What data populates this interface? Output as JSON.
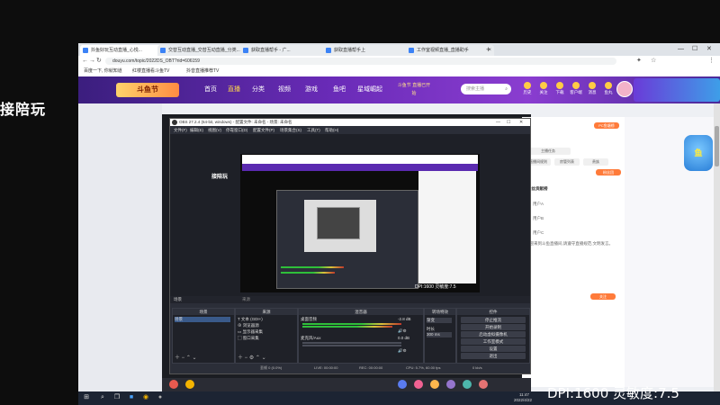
{
  "browser": {
    "tabs": [
      {
        "label": "抖鱼好玩互动直播_心悦...",
        "active": true
      },
      {
        "label": "交替互动直播_交替互动直播_分类..."
      },
      {
        "label": "获取直播帮手 - 广..."
      },
      {
        "label": "获取直播帮手上"
      },
      {
        "label": "工作室视频直播_直播助手"
      }
    ],
    "new_tab": "+",
    "window_controls": [
      "—",
      "☐",
      "✕"
    ],
    "url": "douyu.com/topic/2022DS_OBT?rid=606159",
    "bookmarks": [
      "百度一下, 你就知道",
      "红楼直播看斗鱼TV",
      "抖音直播推荐TV"
    ]
  },
  "site": {
    "logo": "斗鱼节",
    "nav": [
      "首页",
      "直播",
      "分类",
      "视频",
      "游戏",
      "鱼吧",
      "星域崛起"
    ],
    "nav_active": 1,
    "promo": "斗鱼节 直播已开始",
    "search_placeholder": "搜索主播",
    "top_icons": [
      "历史",
      "关注",
      "下载",
      "客户端",
      "消息",
      "鱼丸"
    ]
  },
  "overlay": {
    "left_text": "接陪玩",
    "bottom_text": "DPI:1600 灵敏度:7.5"
  },
  "obs": {
    "title": "OBS 27.2.4 (64-bit, windows) - 配置文件: 未命名 - 场景: 未命名",
    "menu": [
      "文件(F)",
      "编辑(E)",
      "视图(V)",
      "停靠窗口(D)",
      "配置文件(P)",
      "场景集合(S)",
      "工具(T)",
      "帮助(H)"
    ],
    "preview_label": "接陪玩",
    "preview_caption": "DPI:1600 灵敏度:7.5",
    "dock_titles": [
      "场景",
      "来源",
      "混音器",
      "转场特效",
      "控件"
    ],
    "scene_header": "场景",
    "scenes": [
      "场景"
    ],
    "sources_header": "来源",
    "sources": [
      "文本 (GDI+)",
      "浏览器源",
      "显示器采集",
      "窗口采集"
    ],
    "mixer_header": "混音器",
    "mixer": [
      {
        "name": "桌面音频",
        "db": "-2.8 dB"
      },
      {
        "name": "麦克风/Aux",
        "db": "0.0 dB"
      }
    ],
    "transition_header": "转场特效",
    "transition_value": "渐变",
    "transition_duration_label": "时长",
    "transition_duration": "300 ms",
    "controls_header": "控件",
    "controls": [
      "停止推流",
      "开始录制",
      "启动虚拟摄像机",
      "工作室模式",
      "设置",
      "退出"
    ],
    "status": {
      "dropped": "丢帧 0 (0.0%)",
      "live": "LIVE: 00:00:00",
      "rec": "REC: 00:00:00",
      "cpu": "CPU: 5.7%, 60.00 fps",
      "kbps": "0 kb/s"
    }
  },
  "right_panel": {
    "rank_button": "PC鱼塘榜",
    "chips": [
      "主播任务",
      "直播间规则",
      "房管列表",
      "贵族",
      "粉丝团"
    ],
    "fans_title": "粉丝贡献榜",
    "users": [
      "用户A",
      "用户B",
      "用户C"
    ],
    "notice": "欢迎来到斗鱼直播间,请遵守直播规范,文明发言。",
    "follow_button": "关注"
  },
  "taskbar": {
    "time": "11:47",
    "date": "2022/4/22"
  },
  "colors": {
    "accent": "#ff7b3a",
    "obs_bg": "#2b2e38",
    "site_purple": "#5a2ab0"
  }
}
